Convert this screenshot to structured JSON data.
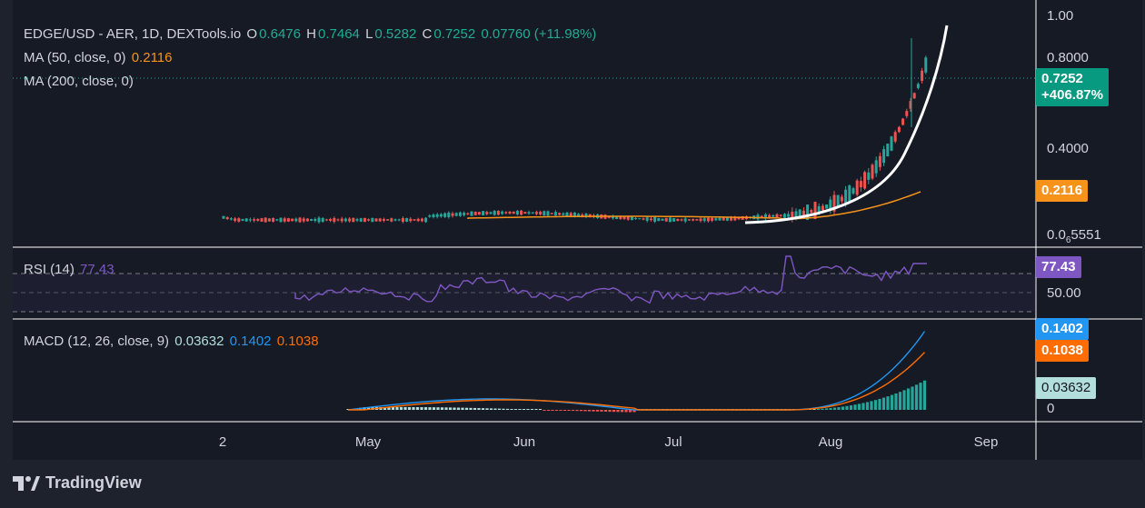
{
  "header": {
    "symbol": "EDGE/USD - AER, 1D, DEXTools.io",
    "o_label": "O",
    "o_value": "0.6476",
    "h_label": "H",
    "h_value": "0.7464",
    "l_label": "L",
    "l_value": "0.5282",
    "c_label": "C",
    "c_value": "0.7252",
    "change": "0.07760 (+11.98%)"
  },
  "ma50": {
    "label": "MA (50, close, 0)",
    "value": "0.2116",
    "color": "#f7931a"
  },
  "ma200": {
    "label": "MA (200, close, 0)"
  },
  "price_axis": {
    "ticks": [
      "1.00",
      "0.8000",
      "0.4000"
    ],
    "bottom_tick_prefix": "0.0",
    "bottom_tick_sub": "6",
    "bottom_tick_suffix": "5551",
    "price_badge": "0.7252",
    "change_badge": "+406.87%",
    "ma_badge": "0.2116"
  },
  "rsi": {
    "label": "RSI (14)",
    "value": "77.43",
    "axis_tick": "50.00",
    "badge": "77.43",
    "color": "#7e57c2"
  },
  "macd": {
    "label": "MACD (12, 26, close, 9)",
    "hist": "0.03632",
    "macd": "0.1402",
    "signal": "0.1038",
    "axis_zero": "0",
    "badge_macd": "0.1402",
    "badge_signal": "0.1038",
    "badge_hist": "0.03632",
    "colors": {
      "macd": "#2196f3",
      "signal": "#ff6d00",
      "hist_pos": "#26a69a",
      "hist_light": "#b2dfdb",
      "hist_neg": "#ef5350"
    }
  },
  "time_axis": [
    "2",
    "May",
    "Jun",
    "Jul",
    "Aug",
    "Sep"
  ],
  "brand": {
    "name": "TradingView",
    "icon": "tradingview-logo-icon"
  },
  "colors": {
    "up": "#26a69a",
    "down": "#ef5350",
    "background": "#161a25",
    "trend_curve": "#ffffff"
  },
  "chart_data": {
    "type": "candlestick",
    "price_range": [
      0.0165551,
      1.0
    ],
    "last": {
      "open": 0.6476,
      "high": 0.7464,
      "low": 0.5282,
      "close": 0.7252
    },
    "ma50_last": 0.2116,
    "rsi_last": 77.43,
    "rsi_ticks": [
      50.0
    ],
    "macd_last": {
      "histogram": 0.03632,
      "macd": 0.1402,
      "signal": 0.1038
    },
    "x_ticks": [
      "2",
      "May",
      "Jun",
      "Jul",
      "Aug",
      "Sep"
    ]
  }
}
